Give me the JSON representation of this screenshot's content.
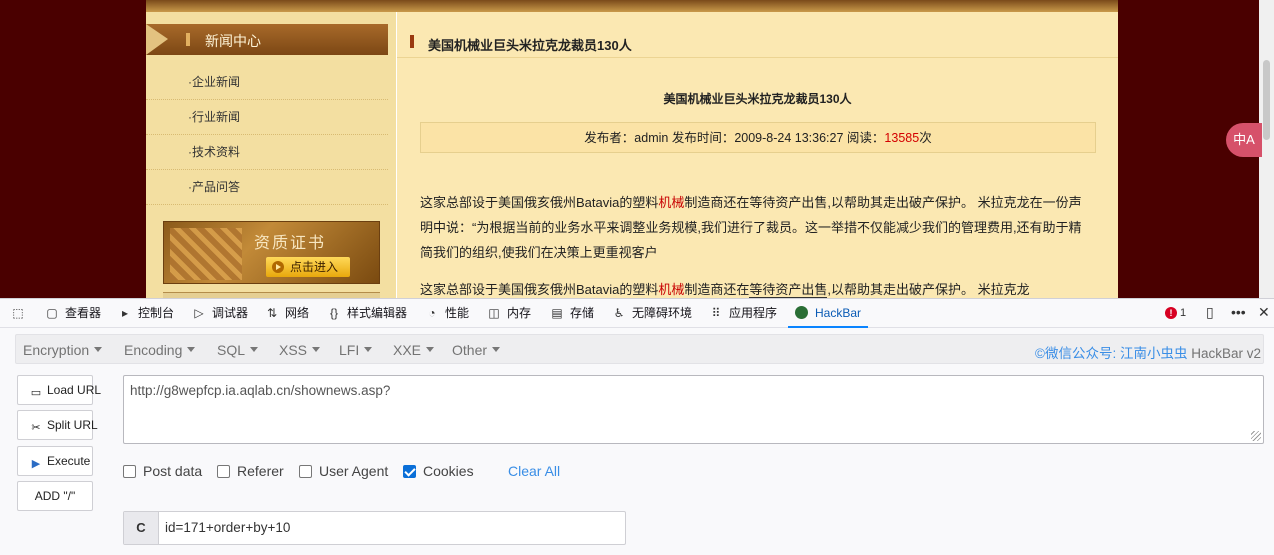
{
  "website": {
    "sidebar": {
      "header": "新闻中心",
      "menu": [
        "·企业新闻",
        "·行业新闻",
        "·技术资料",
        "·产品问答"
      ],
      "cert_banner": {
        "title": "资质证书",
        "button": "点击进入"
      }
    },
    "content": {
      "header": "美国机械业巨头米拉克龙裁员130人",
      "article_title": "美国机械业巨头米拉克龙裁员130人",
      "meta": {
        "prefix": "发布者：admin 发布时间：2009-8-24 13:36:27 阅读：",
        "count": "13585",
        "suffix": "次"
      },
      "para1": {
        "a": "这家总部设于美国俄亥俄州Batavia的塑料",
        "red": "机械",
        "b": "制造商还在等待资产出售,以帮助其走出破产保护。 米拉克龙在一份声明中说：“为根据当前的业务水平来调整业务规模,我们进行了裁员。这一举措不仅能减少我们的管理费用,还有助于精简我们的组织,使我们在决策上更重视客户"
      },
      "para2": {
        "a": "这家总部设于美国俄亥俄州Batavia的塑料",
        "red": "机械",
        "b": "制造商还在",
        "underlined": "等待资产出售",
        "c": ",以帮助其走出破产保护。 米拉克龙"
      }
    },
    "translate_button": "中A"
  },
  "devtools": {
    "tabs": [
      {
        "label": "查看器",
        "icon": "▢"
      },
      {
        "label": "控制台",
        "icon": "▸"
      },
      {
        "label": "调试器",
        "icon": "▷"
      },
      {
        "label": "网络",
        "icon": "⇅"
      },
      {
        "label": "样式编辑器",
        "icon": "{}"
      },
      {
        "label": "性能",
        "icon": "◔"
      },
      {
        "label": "内存",
        "icon": "◫"
      },
      {
        "label": "存储",
        "icon": "▤"
      },
      {
        "label": "无障碍环境",
        "icon": "♿"
      },
      {
        "label": "应用程序",
        "icon": "⠿"
      },
      {
        "label": "HackBar",
        "icon": ""
      }
    ],
    "active_tab": "HackBar",
    "error_count": "1"
  },
  "hackbar": {
    "menu": [
      "Encryption",
      "Encoding",
      "SQL",
      "XSS",
      "LFI",
      "XXE",
      "Other"
    ],
    "credit": "©微信公众号: 江南小虫虫",
    "version": "HackBar v2",
    "buttons": {
      "load": "Load URL",
      "split": "Split URL",
      "execute": "Execute",
      "add_slash": "ADD \"/\""
    },
    "url": "http://g8wepfcp.ia.aqlab.cn/shownews.asp?",
    "options": [
      {
        "label": "Post data",
        "checked": false
      },
      {
        "label": "Referer",
        "checked": false
      },
      {
        "label": "User Agent",
        "checked": false
      },
      {
        "label": "Cookies",
        "checked": true
      }
    ],
    "clear_all": "Clear All",
    "cookie": {
      "label": "C",
      "value": "id=171+order+by+10"
    }
  }
}
